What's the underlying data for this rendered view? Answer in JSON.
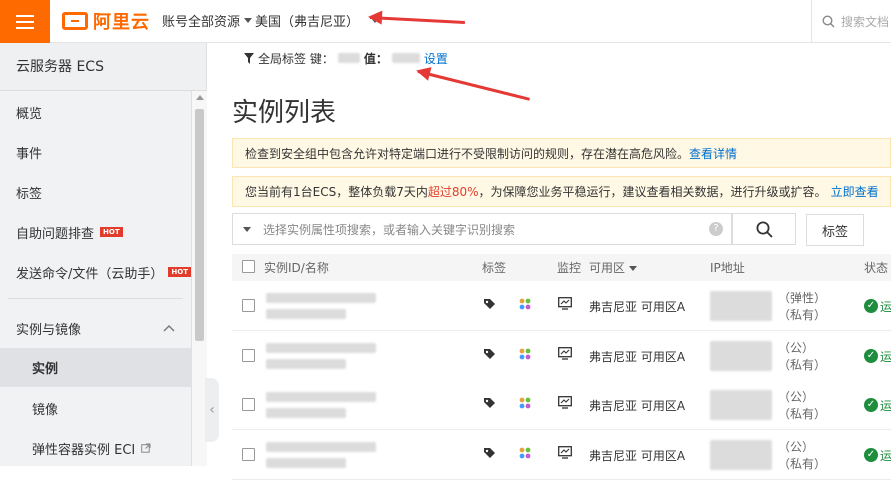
{
  "topbar": {
    "logo_text": "阿里云",
    "account": "账号全部资源",
    "region": "美国（弗吉尼亚）",
    "search_placeholder": "搜索文档"
  },
  "sidebar": {
    "title": "云服务器 ECS",
    "items": [
      {
        "label": "概览"
      },
      {
        "label": "事件"
      },
      {
        "label": "标签"
      },
      {
        "label": "自助问题排查",
        "badge": "HOT"
      },
      {
        "label": "发送命令/文件（云助手）",
        "badge": "HOT"
      },
      {
        "label": "实例与镜像"
      },
      {
        "label": "实例"
      },
      {
        "label": "镜像"
      },
      {
        "label": "弹性容器实例 ECI"
      }
    ]
  },
  "tagbar": {
    "prefix": "全局标签 键：",
    "value_label": "值：",
    "settings": "设置"
  },
  "main": {
    "title": "实例列表",
    "notice1": {
      "text": "检查到安全组中包含允许对特定端口进行不受限制访问的规则，存在潜在高危风险。",
      "link": "查看详情"
    },
    "notice2": {
      "text_before": "您当前有1台ECS，整体负载7天内",
      "highlight": "超过80%",
      "text_after": "，为保障您业务平稳运行，建议查看相关数据，进行升级或扩容。",
      "link": "立即查看"
    },
    "filter_placeholder": "选择实例属性项搜索，或者输入关键字识别搜索",
    "tag_button": "标签"
  },
  "table": {
    "headers": {
      "id": "实例ID/名称",
      "tag": "标签",
      "monitor": "监控",
      "zone": "可用区",
      "ip": "IP地址",
      "status": "状态"
    },
    "rows": [
      {
        "zone": "弗吉尼亚 可用区A",
        "ip1": "（弹性）",
        "ip2": "（私有）",
        "status": "运"
      },
      {
        "zone": "弗吉尼亚 可用区A",
        "ip1": "（公）",
        "ip2": "（私有）",
        "status": "运"
      },
      {
        "zone": "弗吉尼亚 可用区A",
        "ip1": "（公）",
        "ip2": "（私有）",
        "status": "运"
      },
      {
        "zone": "弗吉尼亚 可用区A",
        "ip1": "（公）",
        "ip2": "（私有）",
        "status": "运"
      }
    ]
  },
  "colors": {
    "brand": "#ff6a00",
    "link": "#0070cc",
    "warning_red": "#e23d2c",
    "status_green": "#1e8e3e"
  }
}
